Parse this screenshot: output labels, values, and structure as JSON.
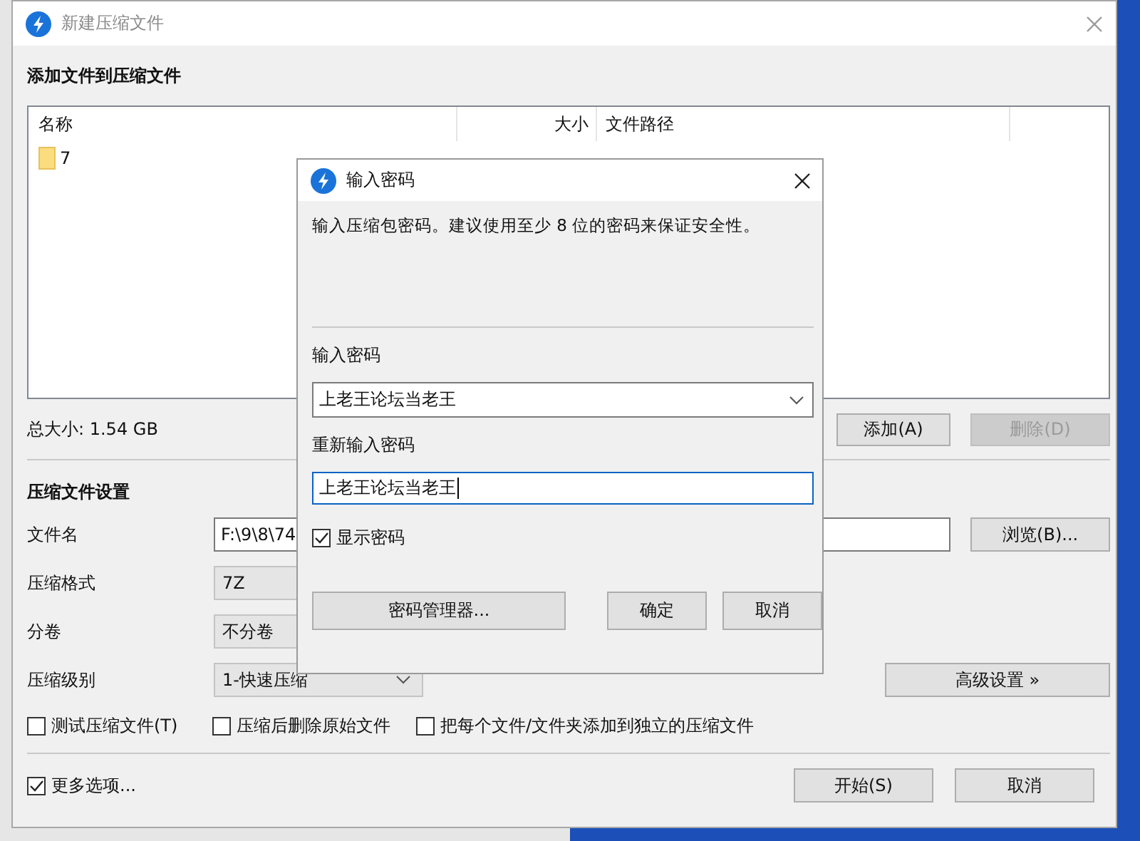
{
  "main_window": {
    "title": "新建压缩文件",
    "section_title": "添加文件到压缩文件",
    "file_list": {
      "columns": [
        "名称",
        "大小",
        "文件路径"
      ],
      "rows": [
        {
          "name": "7"
        }
      ]
    },
    "total_size": "总大小: 1.54 GB",
    "list_buttons": [
      {
        "label": "添加(A)",
        "disabled": false
      },
      {
        "label": "删除(D)",
        "disabled": true
      }
    ],
    "settings_title": "压缩文件设置",
    "fields": [
      {
        "kind": "text",
        "label": "文件名",
        "value": "F:\\9\\8\\74"
      },
      {
        "kind": "combo",
        "label": "压缩格式",
        "value": "7Z"
      },
      {
        "kind": "combo",
        "label": "分卷",
        "value": "不分卷"
      },
      {
        "kind": "select",
        "label": "压缩级别",
        "value": "1-快速压缩"
      }
    ],
    "browse_button": "浏览(B)...",
    "advanced_button": "高级设置 »",
    "options": [
      {
        "label": "测试压缩文件(T)",
        "checked": false
      },
      {
        "label": "压缩后删除原始文件",
        "checked": false
      },
      {
        "label": "把每个文件/文件夹添加到独立的压缩文件",
        "checked": false
      }
    ],
    "more_options": {
      "label": "更多选项...",
      "checked": true
    },
    "footer_buttons": [
      "开始(S)",
      "取消"
    ]
  },
  "dialog": {
    "title": "输入密码",
    "message": "输入压缩包密码。建议使用至少 8 位的密码来保证安全性。",
    "password_label": "输入密码",
    "password_value": "上老王论坛当老王",
    "confirm_label": "重新输入密码",
    "confirm_value": "上老王论坛当老王",
    "show_password": {
      "label": "显示密码",
      "checked": true
    },
    "manager_button": "密码管理器...",
    "ok_button": "确定",
    "cancel_button": "取消"
  }
}
